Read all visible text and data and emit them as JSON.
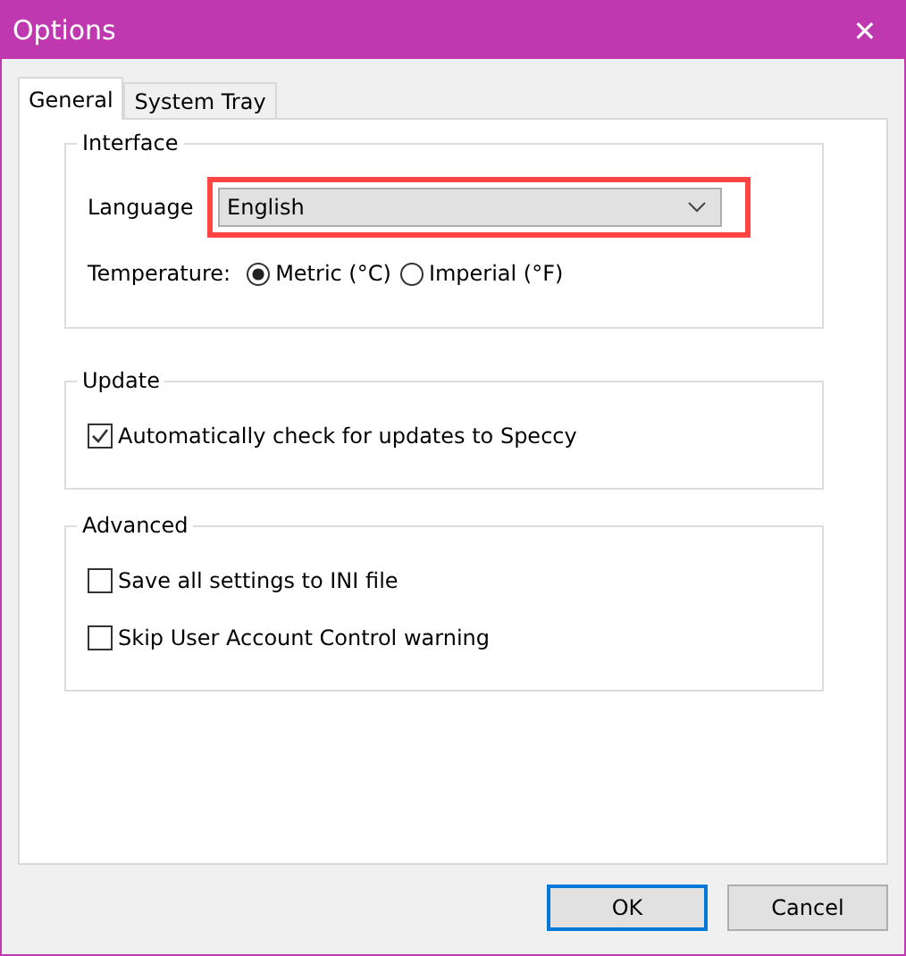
{
  "window": {
    "title": "Options",
    "close": "✕"
  },
  "tabs": [
    {
      "label": "General",
      "selected": true
    },
    {
      "label": "System Tray",
      "selected": false
    }
  ],
  "interface": {
    "title": "Interface",
    "language_label": "Language",
    "language_value": "English",
    "highlighted": true,
    "temperature_label": "Temperature:",
    "temperature_options": [
      {
        "label": "Metric (°C)",
        "selected": true
      },
      {
        "label": "Imperial (°F)",
        "selected": false
      }
    ]
  },
  "update": {
    "title": "Update",
    "options": [
      {
        "label": "Automatically check for updates to Speccy",
        "checked": true
      }
    ]
  },
  "advanced": {
    "title": "Advanced",
    "options": [
      {
        "label": "Save all settings to INI file",
        "checked": false
      },
      {
        "label": "Skip User Account Control warning",
        "checked": false
      }
    ]
  },
  "buttons": [
    {
      "label": "OK",
      "default": true
    },
    {
      "label": "Cancel",
      "default": false
    }
  ]
}
